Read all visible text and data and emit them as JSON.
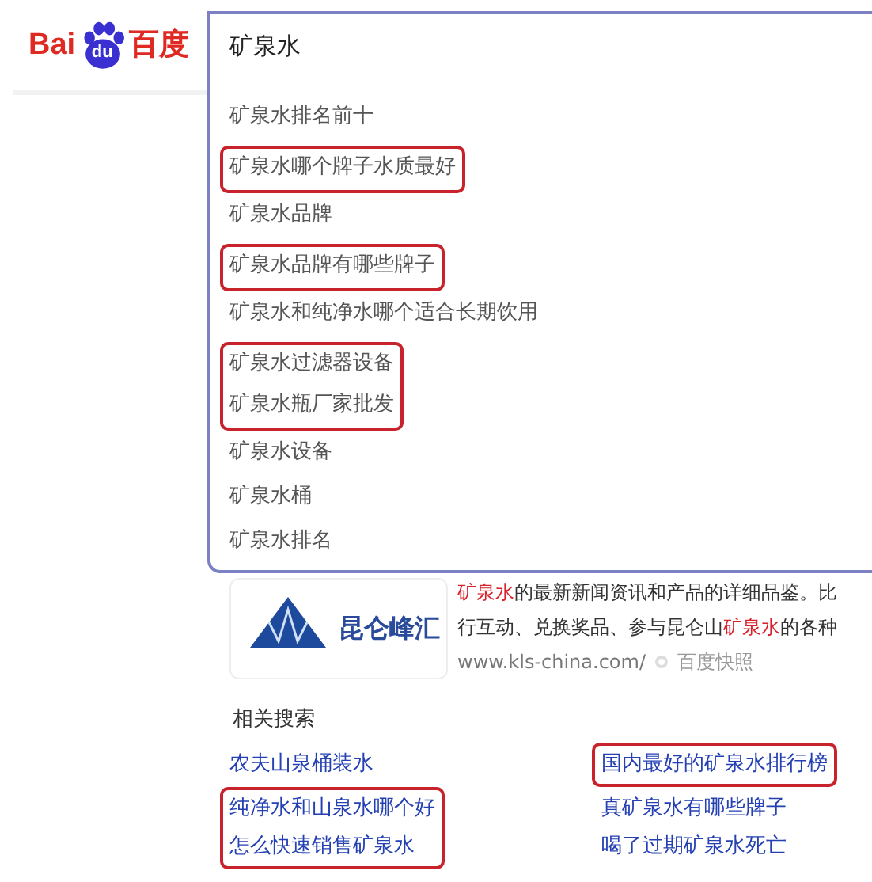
{
  "logo": {
    "left": "Bai",
    "paw": "du",
    "right": "百度"
  },
  "search": {
    "value": "矿泉水",
    "suggestion_groups": [
      {
        "boxed": false,
        "items": [
          "矿泉水排名前十"
        ]
      },
      {
        "boxed": true,
        "items": [
          "矿泉水哪个牌子水质最好"
        ]
      },
      {
        "boxed": false,
        "items": [
          "矿泉水品牌"
        ]
      },
      {
        "boxed": true,
        "items": [
          "矿泉水品牌有哪些牌子"
        ]
      },
      {
        "boxed": false,
        "items": [
          "矿泉水和纯净水哪个适合长期饮用"
        ]
      },
      {
        "boxed": true,
        "items": [
          "矿泉水过滤器设备",
          "矿泉水瓶厂家批发"
        ]
      },
      {
        "boxed": false,
        "items": [
          "矿泉水设备",
          "矿泉水桶",
          "矿泉水排名"
        ]
      }
    ]
  },
  "result": {
    "logo_text": "昆仑峰汇",
    "snippet_lines": [
      [
        {
          "text": "矿泉水",
          "highlight": true
        },
        {
          "text": "的最新新闻资讯和产品的详细品鉴。比",
          "highlight": false
        }
      ],
      [
        {
          "text": "行互动、兑换奖品、参与昆仑山",
          "highlight": false
        },
        {
          "text": "矿泉水",
          "highlight": true
        },
        {
          "text": "的各种",
          "highlight": false
        }
      ]
    ],
    "url": "www.kls-china.com/",
    "snapshot": "百度快照"
  },
  "related": {
    "heading": "相关搜索",
    "columns": [
      [
        {
          "boxed": false,
          "items": [
            "农夫山泉桶装水"
          ]
        },
        {
          "boxed": true,
          "items": [
            "纯净水和山泉水哪个好",
            "怎么快速销售矿泉水"
          ]
        }
      ],
      [
        {
          "boxed": true,
          "items": [
            "国内最好的矿泉水排行榜"
          ]
        },
        {
          "boxed": false,
          "items": [
            "真矿泉水有哪些牌子",
            "喝了过期矿泉水死亡"
          ]
        }
      ]
    ]
  }
}
